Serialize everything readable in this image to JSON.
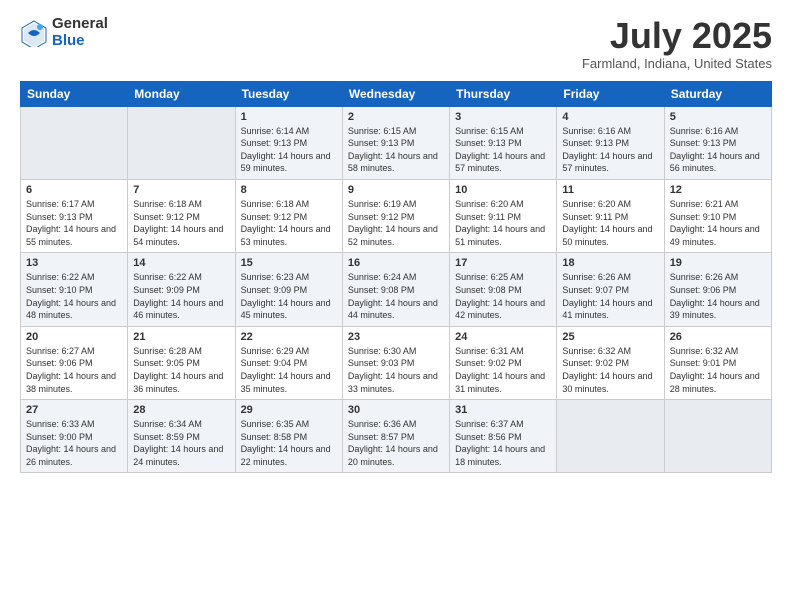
{
  "logo": {
    "general": "General",
    "blue": "Blue"
  },
  "title": "July 2025",
  "location": "Farmland, Indiana, United States",
  "weekdays": [
    "Sunday",
    "Monday",
    "Tuesday",
    "Wednesday",
    "Thursday",
    "Friday",
    "Saturday"
  ],
  "weeks": [
    [
      {
        "day": "",
        "sunrise": "",
        "sunset": "",
        "daylight": ""
      },
      {
        "day": "",
        "sunrise": "",
        "sunset": "",
        "daylight": ""
      },
      {
        "day": "1",
        "sunrise": "Sunrise: 6:14 AM",
        "sunset": "Sunset: 9:13 PM",
        "daylight": "Daylight: 14 hours and 59 minutes."
      },
      {
        "day": "2",
        "sunrise": "Sunrise: 6:15 AM",
        "sunset": "Sunset: 9:13 PM",
        "daylight": "Daylight: 14 hours and 58 minutes."
      },
      {
        "day": "3",
        "sunrise": "Sunrise: 6:15 AM",
        "sunset": "Sunset: 9:13 PM",
        "daylight": "Daylight: 14 hours and 57 minutes."
      },
      {
        "day": "4",
        "sunrise": "Sunrise: 6:16 AM",
        "sunset": "Sunset: 9:13 PM",
        "daylight": "Daylight: 14 hours and 57 minutes."
      },
      {
        "day": "5",
        "sunrise": "Sunrise: 6:16 AM",
        "sunset": "Sunset: 9:13 PM",
        "daylight": "Daylight: 14 hours and 56 minutes."
      }
    ],
    [
      {
        "day": "6",
        "sunrise": "Sunrise: 6:17 AM",
        "sunset": "Sunset: 9:13 PM",
        "daylight": "Daylight: 14 hours and 55 minutes."
      },
      {
        "day": "7",
        "sunrise": "Sunrise: 6:18 AM",
        "sunset": "Sunset: 9:12 PM",
        "daylight": "Daylight: 14 hours and 54 minutes."
      },
      {
        "day": "8",
        "sunrise": "Sunrise: 6:18 AM",
        "sunset": "Sunset: 9:12 PM",
        "daylight": "Daylight: 14 hours and 53 minutes."
      },
      {
        "day": "9",
        "sunrise": "Sunrise: 6:19 AM",
        "sunset": "Sunset: 9:12 PM",
        "daylight": "Daylight: 14 hours and 52 minutes."
      },
      {
        "day": "10",
        "sunrise": "Sunrise: 6:20 AM",
        "sunset": "Sunset: 9:11 PM",
        "daylight": "Daylight: 14 hours and 51 minutes."
      },
      {
        "day": "11",
        "sunrise": "Sunrise: 6:20 AM",
        "sunset": "Sunset: 9:11 PM",
        "daylight": "Daylight: 14 hours and 50 minutes."
      },
      {
        "day": "12",
        "sunrise": "Sunrise: 6:21 AM",
        "sunset": "Sunset: 9:10 PM",
        "daylight": "Daylight: 14 hours and 49 minutes."
      }
    ],
    [
      {
        "day": "13",
        "sunrise": "Sunrise: 6:22 AM",
        "sunset": "Sunset: 9:10 PM",
        "daylight": "Daylight: 14 hours and 48 minutes."
      },
      {
        "day": "14",
        "sunrise": "Sunrise: 6:22 AM",
        "sunset": "Sunset: 9:09 PM",
        "daylight": "Daylight: 14 hours and 46 minutes."
      },
      {
        "day": "15",
        "sunrise": "Sunrise: 6:23 AM",
        "sunset": "Sunset: 9:09 PM",
        "daylight": "Daylight: 14 hours and 45 minutes."
      },
      {
        "day": "16",
        "sunrise": "Sunrise: 6:24 AM",
        "sunset": "Sunset: 9:08 PM",
        "daylight": "Daylight: 14 hours and 44 minutes."
      },
      {
        "day": "17",
        "sunrise": "Sunrise: 6:25 AM",
        "sunset": "Sunset: 9:08 PM",
        "daylight": "Daylight: 14 hours and 42 minutes."
      },
      {
        "day": "18",
        "sunrise": "Sunrise: 6:26 AM",
        "sunset": "Sunset: 9:07 PM",
        "daylight": "Daylight: 14 hours and 41 minutes."
      },
      {
        "day": "19",
        "sunrise": "Sunrise: 6:26 AM",
        "sunset": "Sunset: 9:06 PM",
        "daylight": "Daylight: 14 hours and 39 minutes."
      }
    ],
    [
      {
        "day": "20",
        "sunrise": "Sunrise: 6:27 AM",
        "sunset": "Sunset: 9:06 PM",
        "daylight": "Daylight: 14 hours and 38 minutes."
      },
      {
        "day": "21",
        "sunrise": "Sunrise: 6:28 AM",
        "sunset": "Sunset: 9:05 PM",
        "daylight": "Daylight: 14 hours and 36 minutes."
      },
      {
        "day": "22",
        "sunrise": "Sunrise: 6:29 AM",
        "sunset": "Sunset: 9:04 PM",
        "daylight": "Daylight: 14 hours and 35 minutes."
      },
      {
        "day": "23",
        "sunrise": "Sunrise: 6:30 AM",
        "sunset": "Sunset: 9:03 PM",
        "daylight": "Daylight: 14 hours and 33 minutes."
      },
      {
        "day": "24",
        "sunrise": "Sunrise: 6:31 AM",
        "sunset": "Sunset: 9:02 PM",
        "daylight": "Daylight: 14 hours and 31 minutes."
      },
      {
        "day": "25",
        "sunrise": "Sunrise: 6:32 AM",
        "sunset": "Sunset: 9:02 PM",
        "daylight": "Daylight: 14 hours and 30 minutes."
      },
      {
        "day": "26",
        "sunrise": "Sunrise: 6:32 AM",
        "sunset": "Sunset: 9:01 PM",
        "daylight": "Daylight: 14 hours and 28 minutes."
      }
    ],
    [
      {
        "day": "27",
        "sunrise": "Sunrise: 6:33 AM",
        "sunset": "Sunset: 9:00 PM",
        "daylight": "Daylight: 14 hours and 26 minutes."
      },
      {
        "day": "28",
        "sunrise": "Sunrise: 6:34 AM",
        "sunset": "Sunset: 8:59 PM",
        "daylight": "Daylight: 14 hours and 24 minutes."
      },
      {
        "day": "29",
        "sunrise": "Sunrise: 6:35 AM",
        "sunset": "Sunset: 8:58 PM",
        "daylight": "Daylight: 14 hours and 22 minutes."
      },
      {
        "day": "30",
        "sunrise": "Sunrise: 6:36 AM",
        "sunset": "Sunset: 8:57 PM",
        "daylight": "Daylight: 14 hours and 20 minutes."
      },
      {
        "day": "31",
        "sunrise": "Sunrise: 6:37 AM",
        "sunset": "Sunset: 8:56 PM",
        "daylight": "Daylight: 14 hours and 18 minutes."
      },
      {
        "day": "",
        "sunrise": "",
        "sunset": "",
        "daylight": ""
      },
      {
        "day": "",
        "sunrise": "",
        "sunset": "",
        "daylight": ""
      }
    ]
  ]
}
